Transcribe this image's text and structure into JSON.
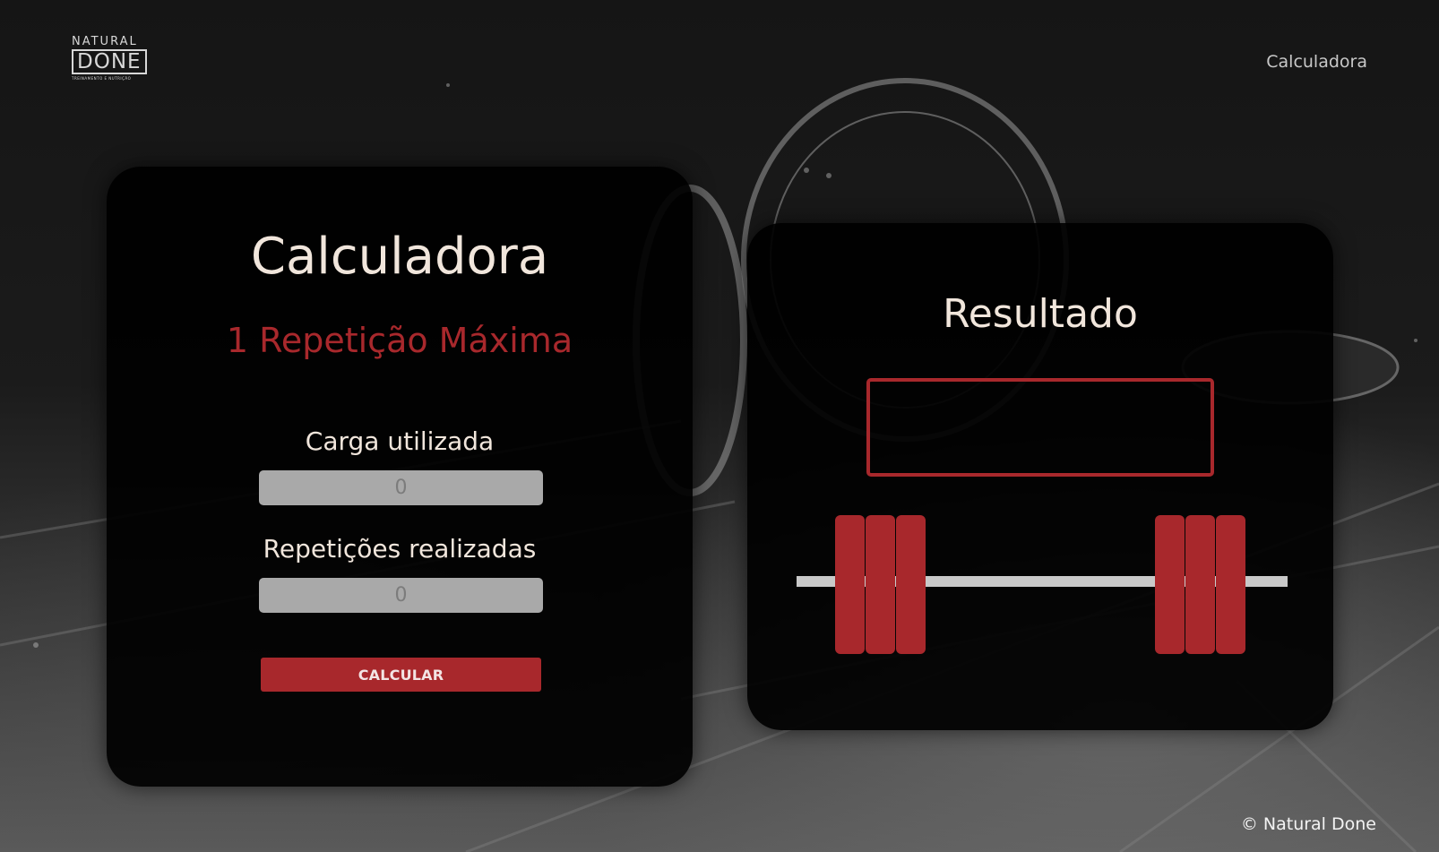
{
  "header": {
    "logo": {
      "line1": "NATURAL",
      "line2": "DONE",
      "tagline": "TREINAMENTO E NUTRIÇÃO"
    },
    "nav_link": "Calculadora"
  },
  "calculator": {
    "title": "Calculadora",
    "subtitle": "1 Repetição Máxima",
    "load_label": "Carga utilizada",
    "load_placeholder": "0",
    "reps_label": "Repetições realizadas",
    "reps_placeholder": "0",
    "button_label": "CALCULAR"
  },
  "result": {
    "title": "Resultado",
    "value": ""
  },
  "footer": {
    "copyright": "© Natural Done"
  },
  "colors": {
    "accent": "#a8282c",
    "text_light": "#f1e6dc",
    "input_bg": "#a9a9a9",
    "card_bg": "#000000"
  }
}
